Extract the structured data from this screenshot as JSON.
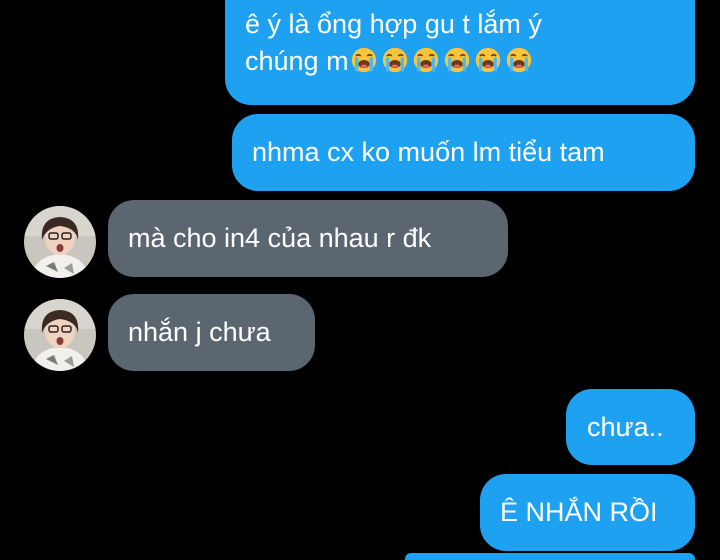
{
  "conversation": {
    "messages": [
      {
        "direction": "outgoing",
        "line1": "ê ý là ổng hợp gu t lắm ý",
        "line2": "chúng m",
        "emoji": "loudly-crying-face-icon",
        "emoji_count": 6
      },
      {
        "direction": "outgoing",
        "text": "nhma cx ko muốn lm tiểu tam"
      },
      {
        "direction": "incoming",
        "text": "mà cho in4 của nhau r đk",
        "avatar": "avatar-icon"
      },
      {
        "direction": "incoming",
        "text": "nhắn j chưa",
        "avatar": "avatar-icon"
      },
      {
        "direction": "outgoing",
        "text": "chưa.."
      },
      {
        "direction": "outgoing",
        "text": "Ê NHẮN RỒI"
      }
    ]
  },
  "colors": {
    "background": "#000000",
    "outgoing_bubble": "#1ea1f1",
    "incoming_bubble": "#5b6670",
    "bubble_text": "#ffffff"
  }
}
